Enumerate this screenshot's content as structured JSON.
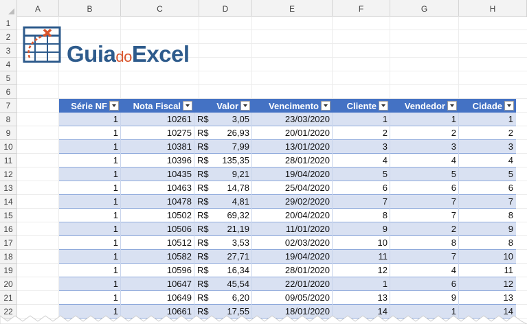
{
  "columns": [
    "A",
    "B",
    "C",
    "D",
    "E",
    "F",
    "G",
    "H"
  ],
  "rows": [
    "1",
    "2",
    "3",
    "4",
    "5",
    "6",
    "7",
    "8",
    "9",
    "10",
    "11",
    "12",
    "13",
    "14",
    "15",
    "16",
    "17",
    "18",
    "19",
    "20",
    "21",
    "22"
  ],
  "logo": {
    "part1": "Guia",
    "part2": "do",
    "part3": "Excel"
  },
  "table": {
    "headers": [
      "Série NF",
      "Nota Fiscal",
      "Valor",
      "Vencimento",
      "Cliente",
      "Vendedor",
      "Cidade"
    ],
    "currency": "R$",
    "rows": [
      [
        "1",
        "10261",
        "3,05",
        "23/03/2020",
        "1",
        "1",
        "1"
      ],
      [
        "1",
        "10275",
        "26,93",
        "20/01/2020",
        "2",
        "2",
        "2"
      ],
      [
        "1",
        "10381",
        "7,99",
        "13/01/2020",
        "3",
        "3",
        "3"
      ],
      [
        "1",
        "10396",
        "135,35",
        "28/01/2020",
        "4",
        "4",
        "4"
      ],
      [
        "1",
        "10435",
        "9,21",
        "19/04/2020",
        "5",
        "5",
        "5"
      ],
      [
        "1",
        "10463",
        "14,78",
        "25/04/2020",
        "6",
        "6",
        "6"
      ],
      [
        "1",
        "10478",
        "4,81",
        "29/02/2020",
        "7",
        "7",
        "7"
      ],
      [
        "1",
        "10502",
        "69,32",
        "20/04/2020",
        "8",
        "7",
        "8"
      ],
      [
        "1",
        "10506",
        "21,19",
        "11/01/2020",
        "9",
        "2",
        "9"
      ],
      [
        "1",
        "10512",
        "3,53",
        "02/03/2020",
        "10",
        "8",
        "8"
      ],
      [
        "1",
        "10582",
        "27,71",
        "19/04/2020",
        "11",
        "7",
        "10"
      ],
      [
        "1",
        "10596",
        "16,34",
        "28/01/2020",
        "12",
        "4",
        "11"
      ],
      [
        "1",
        "10647",
        "45,54",
        "22/01/2020",
        "1",
        "6",
        "12"
      ],
      [
        "1",
        "10649",
        "6,20",
        "09/05/2020",
        "13",
        "9",
        "13"
      ],
      [
        "1",
        "10661",
        "17,55",
        "18/01/2020",
        "14",
        "1",
        "14"
      ]
    ]
  },
  "colors": {
    "header_blue": "#4472c4",
    "band": "#d9e1f2",
    "logo_blue": "#2e5b8c",
    "logo_orange": "#d9542b"
  }
}
